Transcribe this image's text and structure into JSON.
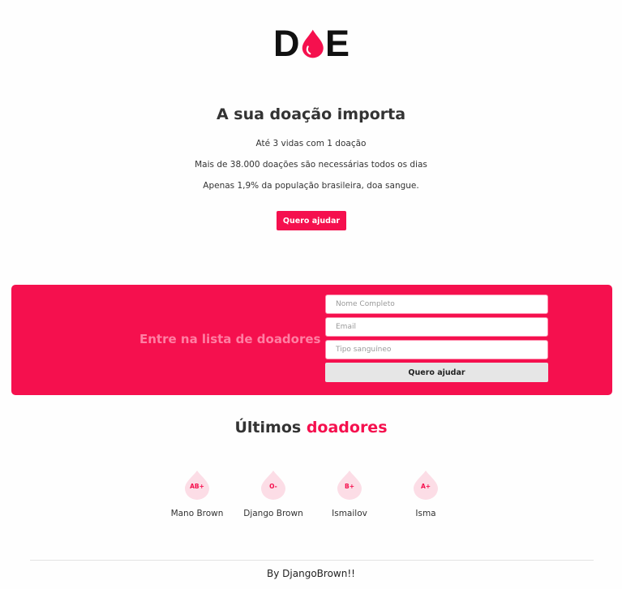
{
  "header": {
    "logo_text_left": "D",
    "logo_text_right": "E"
  },
  "hero": {
    "title": "A sua doação importa",
    "line1": "Até 3 vidas com 1 doação",
    "line2": "Mais de 38.000 doações são necessárias todos os dias",
    "line3": "Apenas 1,9% da população brasileira, doa sangue.",
    "button_label": "Quero ajudar"
  },
  "signup": {
    "title": "Entre na lista de doadores",
    "name_placeholder": "Nome Completo",
    "email_placeholder": "Email",
    "blood_placeholder": "Tipo sanguíneo",
    "button_label": "Quero ajudar"
  },
  "donors": {
    "title_main": "Últimos",
    "title_accent": "doadores",
    "items": [
      {
        "blood_type": "AB+",
        "name": "Mano Brown"
      },
      {
        "blood_type": "O-",
        "name": "Django Brown"
      },
      {
        "blood_type": "B+",
        "name": "Ismailov"
      },
      {
        "blood_type": "A+",
        "name": "Isma"
      }
    ]
  },
  "footer": {
    "text": "By DjangoBrown!!"
  },
  "colors": {
    "brand": "#f5104e",
    "drop_bg": "#fcdde6",
    "text": "#333333"
  },
  "icons": {
    "logo_drop": "blood-drop-icon",
    "donor_drop": "blood-drop-icon"
  }
}
